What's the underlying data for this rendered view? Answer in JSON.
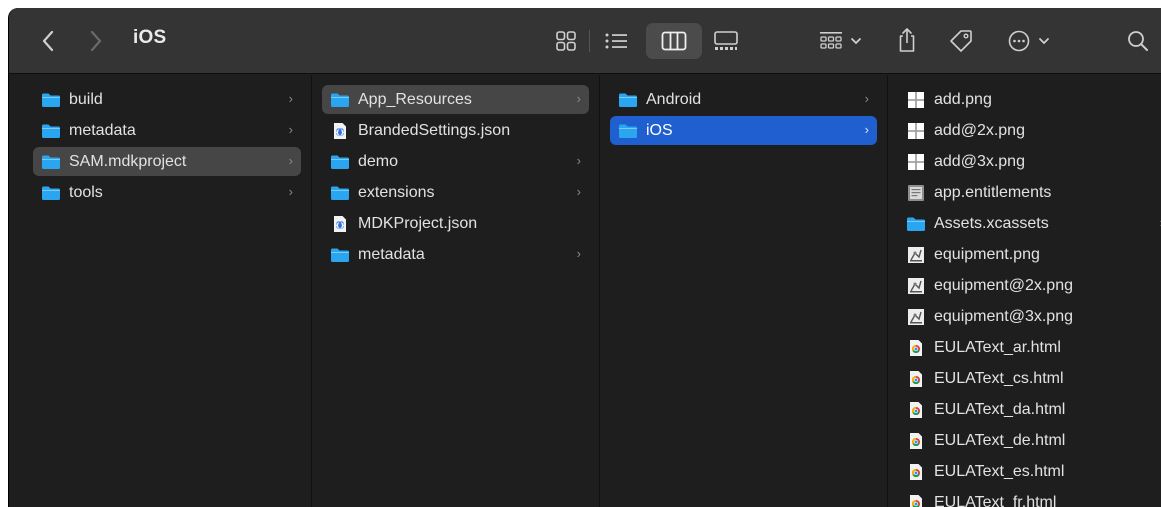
{
  "window": {
    "title": "iOS"
  },
  "colors": {
    "folder": "#2aa6f1",
    "selection_blue": "#1f5fcf",
    "selection_gray": "#464646"
  },
  "columns": [
    {
      "items": [
        {
          "label": "build",
          "icon": "folder-icon",
          "has_children": true
        },
        {
          "label": "metadata",
          "icon": "folder-icon",
          "has_children": true
        },
        {
          "label": "SAM.mdkproject",
          "icon": "folder-icon",
          "has_children": true,
          "selected": "gray"
        },
        {
          "label": "tools",
          "icon": "folder-icon",
          "has_children": true
        }
      ]
    },
    {
      "items": [
        {
          "label": "App_Resources",
          "icon": "folder-icon",
          "has_children": true,
          "selected": "gray"
        },
        {
          "label": "BrandedSettings.json",
          "icon": "json-file-icon",
          "has_children": false
        },
        {
          "label": "demo",
          "icon": "folder-icon",
          "has_children": true
        },
        {
          "label": "extensions",
          "icon": "folder-icon",
          "has_children": true
        },
        {
          "label": "MDKProject.json",
          "icon": "json-file-icon",
          "has_children": false
        },
        {
          "label": "metadata",
          "icon": "folder-icon",
          "has_children": true
        }
      ]
    },
    {
      "items": [
        {
          "label": "Android",
          "icon": "folder-icon",
          "has_children": true
        },
        {
          "label": "iOS",
          "icon": "folder-icon",
          "has_children": true,
          "selected": "blue"
        }
      ]
    },
    {
      "items": [
        {
          "label": "add.png",
          "icon": "png-thumbnail-icon",
          "has_children": false
        },
        {
          "label": "add@2x.png",
          "icon": "png-thumbnail-icon",
          "has_children": false
        },
        {
          "label": "add@3x.png",
          "icon": "png-thumbnail-icon",
          "has_children": false
        },
        {
          "label": "app.entitlements",
          "icon": "entitlements-file-icon",
          "has_children": false
        },
        {
          "label": "Assets.xcassets",
          "icon": "folder-icon",
          "has_children": true
        },
        {
          "label": "equipment.png",
          "icon": "equipment-image-icon",
          "has_children": false
        },
        {
          "label": "equipment@2x.png",
          "icon": "equipment-image-icon",
          "has_children": false
        },
        {
          "label": "equipment@3x.png",
          "icon": "equipment-image-icon",
          "has_children": false
        },
        {
          "label": "EULAText_ar.html",
          "icon": "html-file-icon",
          "has_children": false
        },
        {
          "label": "EULAText_cs.html",
          "icon": "html-file-icon",
          "has_children": false
        },
        {
          "label": "EULAText_da.html",
          "icon": "html-file-icon",
          "has_children": false
        },
        {
          "label": "EULAText_de.html",
          "icon": "html-file-icon",
          "has_children": false
        },
        {
          "label": "EULAText_es.html",
          "icon": "html-file-icon",
          "has_children": false
        },
        {
          "label": "EULAText_fr.html",
          "icon": "html-file-icon",
          "has_children": false
        }
      ]
    }
  ]
}
